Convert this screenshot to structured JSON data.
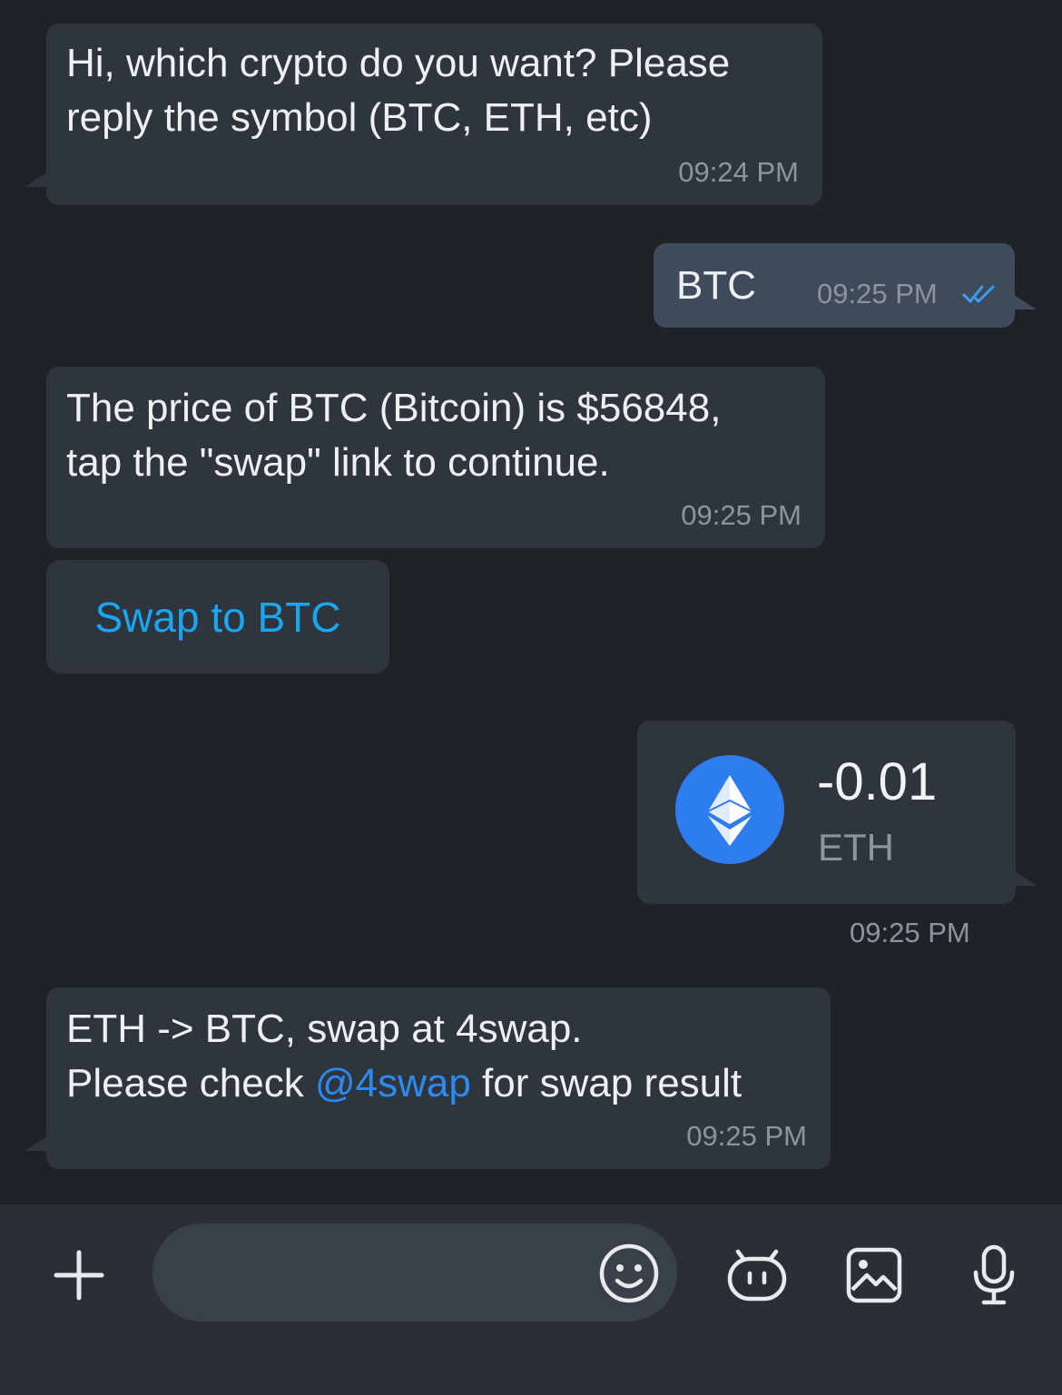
{
  "messages": {
    "m1": {
      "text_line1": "Hi, which crypto do you want? Please",
      "text_line2": "reply the symbol (BTC, ETH, etc)",
      "time": "09:24 PM"
    },
    "m2": {
      "text": "BTC",
      "time": "09:25 PM",
      "status": "read-double-check"
    },
    "m3": {
      "text_line1": "The price of BTC (Bitcoin) is $56848,",
      "text_line2": "tap the \"swap\" link to continue.",
      "time": "09:25 PM"
    },
    "action_button": {
      "label": "Swap to BTC"
    },
    "transfer": {
      "amount": "-0.01",
      "symbol": "ETH",
      "time": "09:25 PM",
      "icon": "ethereum-icon"
    },
    "m5": {
      "text_line1": "ETH -> BTC, swap at 4swap.",
      "text_prefix": "Please check ",
      "mention": "@4swap",
      "text_suffix": " for swap result",
      "time": "09:25 PM"
    }
  },
  "input_bar": {
    "placeholder": "",
    "icons": [
      "plus-icon",
      "emoji-icon",
      "bot-icon",
      "image-icon",
      "microphone-icon"
    ]
  },
  "colors": {
    "background": "#1f2328",
    "incoming_bubble": "#2f353d",
    "outgoing_bubble": "#3f4a5a",
    "link": "#2a8bf2",
    "action_text": "#1aa6f0",
    "eth_blue": "#2d7df0"
  }
}
